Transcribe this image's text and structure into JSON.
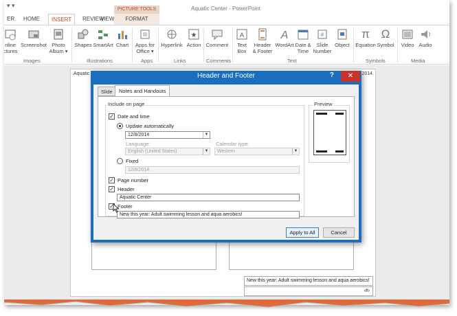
{
  "app": {
    "title": "Aquatic Center - PowerPoint",
    "contextual_group": "PICTURE TOOLS"
  },
  "tabs": {
    "file_partial": "ER",
    "home": "HOME",
    "insert": "INSERT",
    "review": "REVIEW",
    "view": "VIEW",
    "format": "FORMAT"
  },
  "ribbon": {
    "images": {
      "label": "Images",
      "online_pictures": "nline\nctures",
      "screenshot": "Screenshot",
      "photo_album": "Photo\nAlbum ▾"
    },
    "illustrations": {
      "label": "Illustrations",
      "shapes": "Shapes",
      "smartart": "SmartArt",
      "chart": "Chart"
    },
    "apps": {
      "label": "Apps",
      "apps_for_office": "Apps for\nOffice ▾"
    },
    "links": {
      "label": "Links",
      "hyperlink": "Hyperlink",
      "action": "Action"
    },
    "comments": {
      "label": "Comments",
      "comment": "Comment"
    },
    "text": {
      "label": "Text",
      "text_box": "Text\nBox",
      "header_footer": "Header\n& Footer",
      "wordart": "WordArt",
      "date_time": "Date &\nTime",
      "slide_number": "Slide\nNumber",
      "object": "Object"
    },
    "symbols": {
      "label": "Symbols",
      "equation": "Equation",
      "symbol": "Symbol"
    },
    "media": {
      "label": "Media",
      "video": "Video",
      "audio": "Audio"
    }
  },
  "slide": {
    "header_text": "Aquatic",
    "date_text": "2014",
    "footer_text": "New this year: Adult swimming lesson and aqua aerobics!",
    "page_number_text": "‹#›"
  },
  "dialog": {
    "title": "Header and Footer",
    "help": "?",
    "close": "✕",
    "tab_slide": "Slide",
    "tab_notes": "Notes and Handouts",
    "include_label": "Include on page",
    "date_and_time": {
      "label": "Date and time",
      "checked": true
    },
    "update_automatically": {
      "label": "Update automatically",
      "selected": true
    },
    "auto_date_value": "12/8/2014",
    "language_label": "Language:",
    "language_value": "English (United States)",
    "calendar_label": "Calendar type:",
    "calendar_value": "Western",
    "fixed": {
      "label": "Fixed",
      "selected": false
    },
    "fixed_value": "12/8/2014",
    "page_number": {
      "label": "Page number",
      "checked": true
    },
    "header": {
      "label": "Header",
      "checked": true
    },
    "header_value": "Aquatic Center",
    "footer": {
      "label": "Footer",
      "checked": true
    },
    "footer_value": "New this year: Adult swimming lesson and aqua aerobics!",
    "preview_label": "Preview",
    "apply_to_all": "Apply to All",
    "cancel": "Cancel"
  },
  "colors": {
    "accent": "#d24726",
    "dialog_title_bar": "#1a6ebf",
    "close_button": "#c7352b"
  }
}
